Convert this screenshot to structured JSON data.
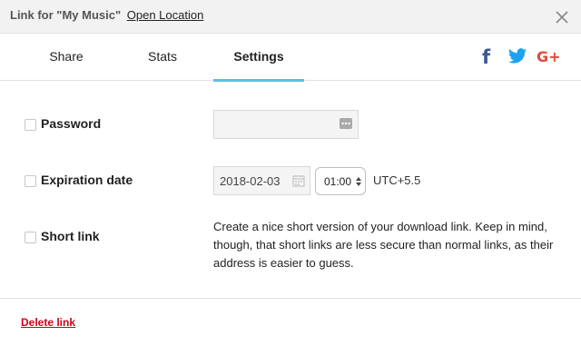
{
  "dialog": {
    "title": "Link for \"My Music\"",
    "open_location_label": "Open Location"
  },
  "tabs": [
    {
      "label": "Share",
      "active": false
    },
    {
      "label": "Stats",
      "active": false
    },
    {
      "label": "Settings",
      "active": true
    }
  ],
  "social": {
    "icons": [
      "facebook-icon",
      "twitter-icon",
      "google-plus-icon"
    ],
    "facebook_glyph": "f",
    "googleplus_glyph": "G+"
  },
  "settings": {
    "password": {
      "label": "Password",
      "checked": false,
      "value": ""
    },
    "expiration": {
      "label": "Expiration date",
      "checked": false,
      "date": "2018-02-03",
      "time": "01:00",
      "timezone": "UTC+5.5"
    },
    "short_link": {
      "label": "Short link",
      "checked": false,
      "description": "Create a nice short version of your download link. Keep in mind, though, that short links are less secure than normal links, as their address is easier to guess."
    }
  },
  "footer": {
    "delete_label": "Delete link"
  },
  "colors": {
    "accent": "#5bc0de",
    "danger": "#d0021b",
    "facebook": "#3b5998",
    "twitter": "#1da1f2",
    "googleplus": "#dd4b39"
  }
}
